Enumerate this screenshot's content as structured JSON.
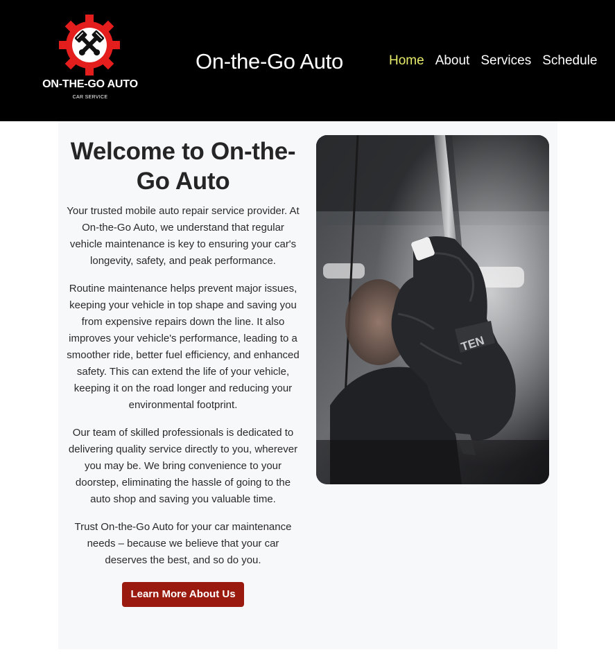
{
  "header": {
    "logo_name": "ON-THE-GO AUTO",
    "logo_tagline": "CAR SERVICE",
    "site_title": "On-the-Go Auto",
    "nav": [
      {
        "label": "Home",
        "active": true
      },
      {
        "label": "About",
        "active": false
      },
      {
        "label": "Services",
        "active": false
      },
      {
        "label": "Schedule",
        "active": false
      }
    ]
  },
  "main": {
    "heading": "Welcome to On-the-Go Auto",
    "paragraphs": [
      "Your trusted mobile auto repair service provider. At On-the-Go Auto, we understand that regular vehicle maintenance is key to ensuring your car's longevity, safety, and peak performance.",
      "Routine maintenance helps prevent major issues, keeping your vehicle in top shape and saving you from expensive repairs down the line. It also improves your vehicle's performance, leading to a smoother ride, better fuel efficiency, and enhanced safety. This can extend the life of your vehicle, keeping it on the road longer and reducing your environmental footprint.",
      "Our team of skilled professionals is dedicated to delivering quality service directly to you, wherever you may be. We bring convenience to your doorstep, eliminating the hassle of going to the auto shop and saving you valuable time.",
      "Trust On-the-Go Auto for your car maintenance needs – because we believe that your car deserves the best, and so do you."
    ],
    "cta_label": "Learn More About Us",
    "hero_image_glove_text": "TEN"
  },
  "colors": {
    "header_bg": "#000000",
    "nav_active": "#e7ec6b",
    "logo_red": "#e41d1d",
    "cta_bg": "#9a1a10",
    "main_bg": "#f7f8f9"
  },
  "icons": {
    "logo": "gear-with-crossed-pistons-icon"
  }
}
